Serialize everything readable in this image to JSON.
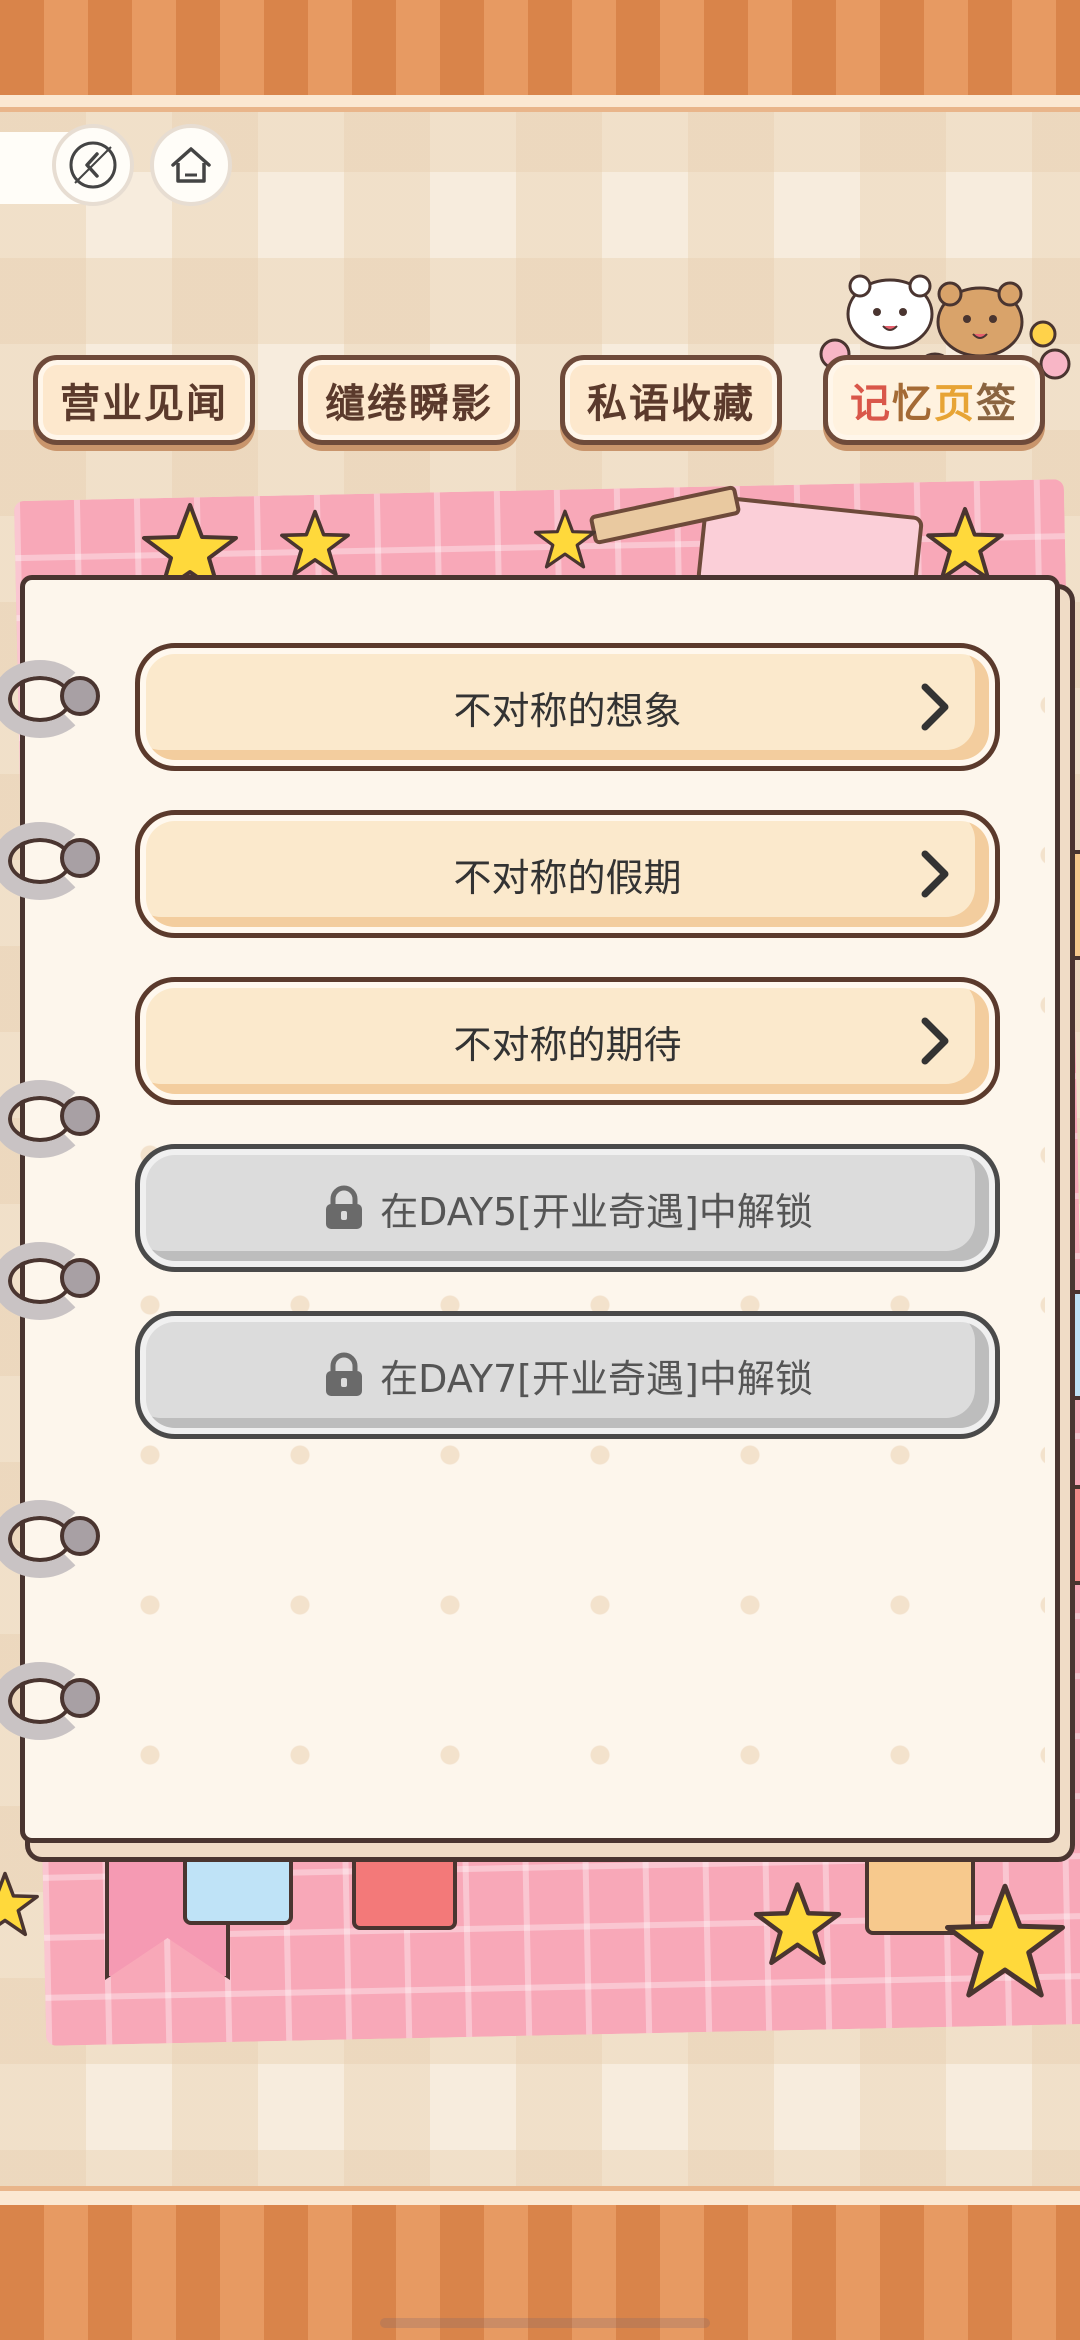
{
  "nav": {
    "back_icon": "back-arrow-icon",
    "home_icon": "home-icon"
  },
  "tabs": [
    {
      "label": "营业见闻",
      "active": false
    },
    {
      "label": "缱绻瞬影",
      "active": false
    },
    {
      "label": "私语收藏",
      "active": false
    },
    {
      "label_parts": [
        "记",
        "忆",
        "页",
        "签"
      ],
      "active": true
    }
  ],
  "chapters": [
    {
      "label": "不对称的想象",
      "locked": false
    },
    {
      "label": "不对称的假期",
      "locked": false
    },
    {
      "label": "不对称的期待",
      "locked": false
    },
    {
      "label": "在DAY5[开业奇遇]中解锁",
      "locked": true
    },
    {
      "label": "在DAY7[开业奇遇]中解锁",
      "locked": true
    }
  ],
  "colors": {
    "band": "#d9844a",
    "tab_border": "#6e4a3a",
    "chapter_bg": "#fbe9cc",
    "locked_bg": "#dcdcdc",
    "pink": "#f8a8b8",
    "star": "#ffd93b"
  }
}
